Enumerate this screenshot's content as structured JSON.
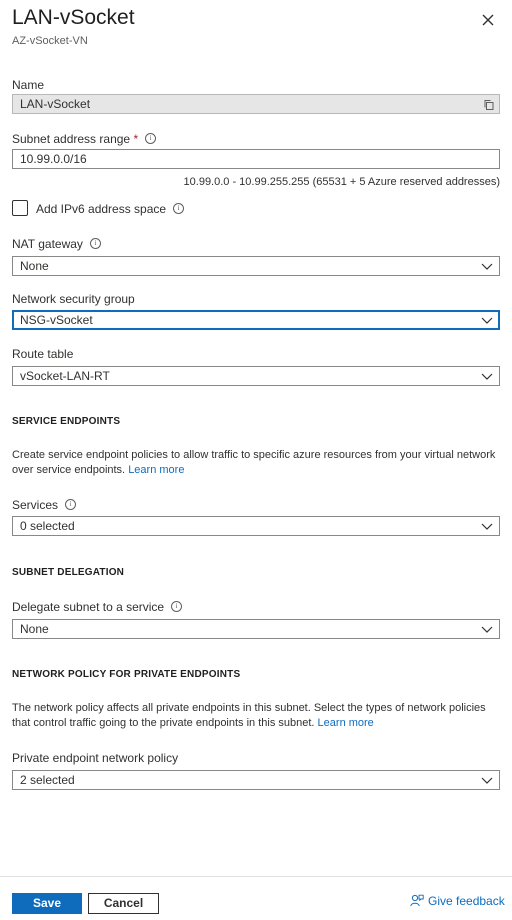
{
  "header": {
    "title": "LAN-vSocket",
    "subtitle": "AZ-vSocket-VN"
  },
  "name": {
    "label": "Name",
    "value": "LAN-vSocket"
  },
  "subnet_range": {
    "label": "Subnet address range",
    "required_marker": "*",
    "value": "10.99.0.0/16",
    "hint": "10.99.0.0 - 10.99.255.255 (65531 + 5 Azure reserved addresses)"
  },
  "ipv6": {
    "label": "Add IPv6 address space",
    "checked": false
  },
  "nat_gateway": {
    "label": "NAT gateway",
    "value": "None"
  },
  "nsg": {
    "label": "Network security group",
    "value": "NSG-vSocket"
  },
  "route_table": {
    "label": "Route table",
    "value": "vSocket-LAN-RT"
  },
  "service_endpoints": {
    "heading": "SERVICE ENDPOINTS",
    "description": "Create service endpoint policies to allow traffic to specific azure resources from your virtual network over service endpoints.",
    "learn_more": "Learn more",
    "services_label": "Services",
    "services_value": "0 selected"
  },
  "subnet_delegation": {
    "heading": "SUBNET DELEGATION",
    "label": "Delegate subnet to a service",
    "value": "None"
  },
  "network_policy": {
    "heading": "NETWORK POLICY FOR PRIVATE ENDPOINTS",
    "description": "The network policy affects all private endpoints in this subnet. Select the types of network policies that control traffic going to the private endpoints in this subnet.",
    "learn_more": "Learn more",
    "label": "Private endpoint network policy",
    "value": "2 selected"
  },
  "footer": {
    "save": "Save",
    "cancel": "Cancel",
    "feedback": "Give feedback"
  },
  "info_glyph": "i",
  "colors": {
    "accent": "#0f6cbd",
    "required": "#a4262c",
    "disabled_bg": "#e6e6e6"
  },
  "icons": [
    "close-icon",
    "copy-icon",
    "info-icon",
    "chevron-down-icon",
    "feedback-icon"
  ]
}
